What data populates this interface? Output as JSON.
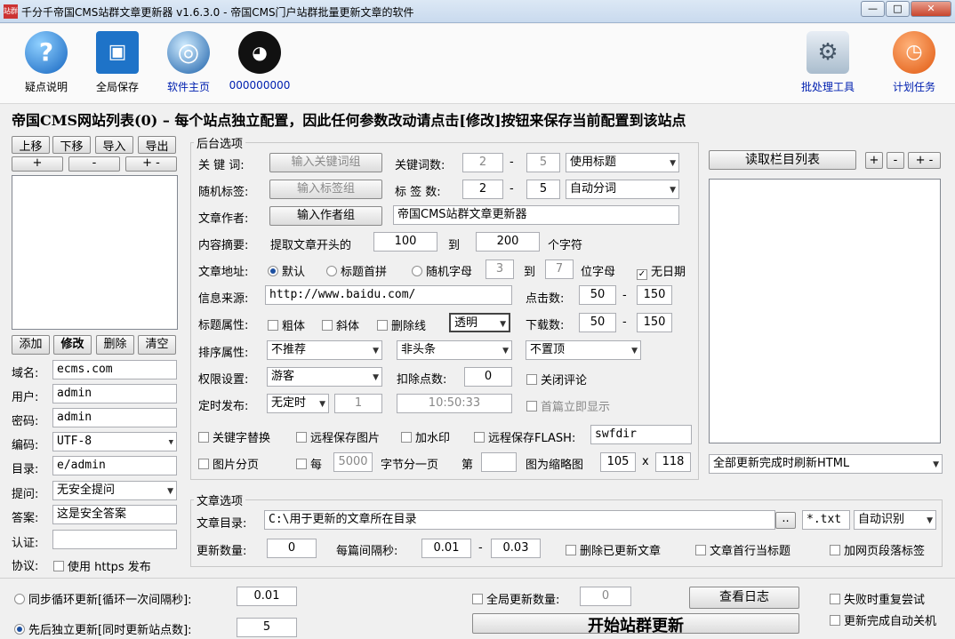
{
  "window": {
    "title": "千分千帝国CMS站群文章更新器 v1.6.3.0 - 帝国CMS门户站群批量更新文章的软件",
    "icon_text": "站群"
  },
  "toolbar": {
    "faq": "疑点说明",
    "save_all": "全局保存",
    "homepage": "软件主页",
    "qq": "000000000",
    "batch_tool": "批处理工具",
    "schedule": "计划任务"
  },
  "heading": "帝国CMS网站列表(0) – 每个站点独立配置，因此任何参数改动请点击[修改]按钮来保存当前配置到该站点",
  "site_list": {
    "move_up": "上移",
    "move_down": "下移",
    "import": "导入",
    "export": "导出",
    "plus": "+",
    "minus": "-",
    "plus_minus": "+ -",
    "add": "添加",
    "modify": "修改",
    "delete": "删除",
    "clear": "清空"
  },
  "site_form": {
    "domain_label": "域名:",
    "domain": "ecms.com",
    "user_label": "用户:",
    "user": "admin",
    "password_label": "密码:",
    "password": "admin",
    "encoding_label": "编码:",
    "encoding": "UTF-8",
    "dir_label": "目录:",
    "dir": "e/admin",
    "question_label": "提问:",
    "question": "无安全提问",
    "answer_label": "答案:",
    "answer": "这是安全答案",
    "auth_label": "认证:",
    "auth": "",
    "protocol_label": "协议:",
    "https_label": "使用 https 发布"
  },
  "backend": {
    "group_title": "后台选项",
    "keyword_label": "关 键 词:",
    "keyword_btn": "输入关键词组",
    "keyword_count_label": "关键词数:",
    "keyword_min": "2",
    "keyword_max": "5",
    "keyword_mode": "使用标题",
    "tag_label": "随机标签:",
    "tag_btn": "输入标签组",
    "tag_count_label": "标 签 数:",
    "tag_min": "2",
    "tag_max": "5",
    "tag_mode": "自动分词",
    "author_label": "文章作者:",
    "author_btn": "输入作者组",
    "author_value": "帝国CMS站群文章更新器",
    "summary_label": "内容摘要:",
    "summary_text": "提取文章开头的",
    "summary_min": "100",
    "summary_to": "到",
    "summary_max": "200",
    "summary_unit": "个字符",
    "url_label": "文章地址:",
    "url_default": "默认",
    "url_pinyin": "标题首拼",
    "url_random": "随机字母",
    "url_min": "3",
    "url_to": "到",
    "url_max": "7",
    "url_unit": "位字母",
    "url_nodate": "无日期",
    "source_label": "信息来源:",
    "source": "http://www.baidu.com/",
    "clicks_label": "点击数:",
    "clicks_min": "50",
    "clicks_max": "150",
    "title_attr_label": "标题属性:",
    "bold": "粗体",
    "italic": "斜体",
    "strike": "删除线",
    "color": "透明",
    "downloads_label": "下载数:",
    "downloads_min": "50",
    "downloads_max": "150",
    "sort_label": "排序属性:",
    "recommend": "不推荐",
    "headline": "非头条",
    "top": "不置顶",
    "perm_label": "权限设置:",
    "perm": "游客",
    "deduct_label": "扣除点数:",
    "deduct": "0",
    "close_comment": "关闭评论",
    "timer_label": "定时发布:",
    "timer": "无定时",
    "timer_count": "1",
    "timer_time": "10:50:33",
    "first_show": "首篇立即显示",
    "kw_replace": "关键字替换",
    "remote_img": "远程保存图片",
    "watermark": "加水印",
    "remote_flash": "远程保存FLASH:",
    "flash_dir": "swfdir",
    "paging": "图片分页",
    "every": "每",
    "every_bytes": "5000",
    "bytes_unit": "字节分一页",
    "nth_label": "第",
    "nth": "",
    "thumb_label": "图为缩略图",
    "thumb_w": "105",
    "thumb_x": "x",
    "thumb_h": "118"
  },
  "columns": {
    "read_btn": "读取栏目列表",
    "plus": "+",
    "minus": "-",
    "plus_minus": "+ -",
    "refresh": "全部更新完成时刷新HTML"
  },
  "article": {
    "group_title": "文章选项",
    "dir_label": "文章目录:",
    "dir": "C:\\用于更新的文章所在目录",
    "browse": "..",
    "ext": "*.txt",
    "encoding": "自动识别",
    "count_label": "更新数量:",
    "count": "0",
    "interval_label": "每篇间隔秒:",
    "interval_min": "0.01",
    "interval_max": "0.03",
    "delete_updated": "删除已更新文章",
    "first_line_title": "文章首行当标题",
    "paragraph_tag": "加网页段落标签"
  },
  "bottom": {
    "sync_loop": "同步循环更新[循环一次间隔秒]:",
    "sync_interval": "0.01",
    "seq_update": "先后独立更新[同时更新站点数]:",
    "seq_count": "5",
    "global_count_label": "全局更新数量:",
    "global_count": "0",
    "view_log": "查看日志",
    "start": "开始站群更新",
    "retry_fail": "失败时重复尝试",
    "shutdown": "更新完成自动关机"
  }
}
